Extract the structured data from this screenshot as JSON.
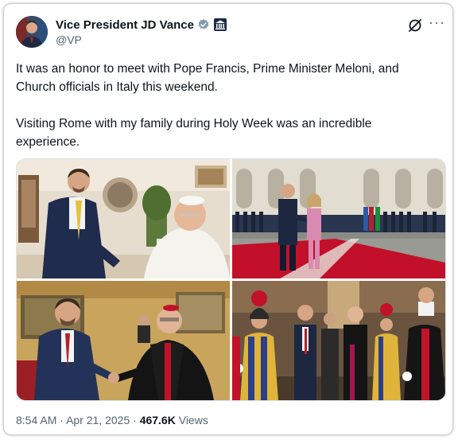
{
  "author": {
    "name": "Vice President JD Vance",
    "handle": "@VP",
    "avatar_icon": "person-avatar",
    "verified_icon": "verified-badge-icon",
    "affiliation_icon": "government-building-icon"
  },
  "actions": {
    "grok_icon": "grok-icon",
    "more_label": "···"
  },
  "post": {
    "paragraph1": "It was an honor to meet with Pope Francis, Prime Minister Meloni, and Church officials in Italy this weekend.",
    "paragraph2": "Visiting Rome with my family during Holy Week was an incredible experience."
  },
  "media": [
    {
      "name": "photo-meeting-pope-francis"
    },
    {
      "name": "photo-meeting-prime-minister-meloni"
    },
    {
      "name": "photo-handshake-church-official"
    },
    {
      "name": "photo-swiss-guard-corridor"
    }
  ],
  "meta": {
    "time": "8:54 AM",
    "separator": "·",
    "date": "Apr 21, 2025",
    "views_count": "467.6K",
    "views_label": "Views"
  },
  "colors": {
    "text": "#0f1419",
    "secondary": "#536471",
    "verified": "#829aab",
    "border": "#c9ced3"
  }
}
